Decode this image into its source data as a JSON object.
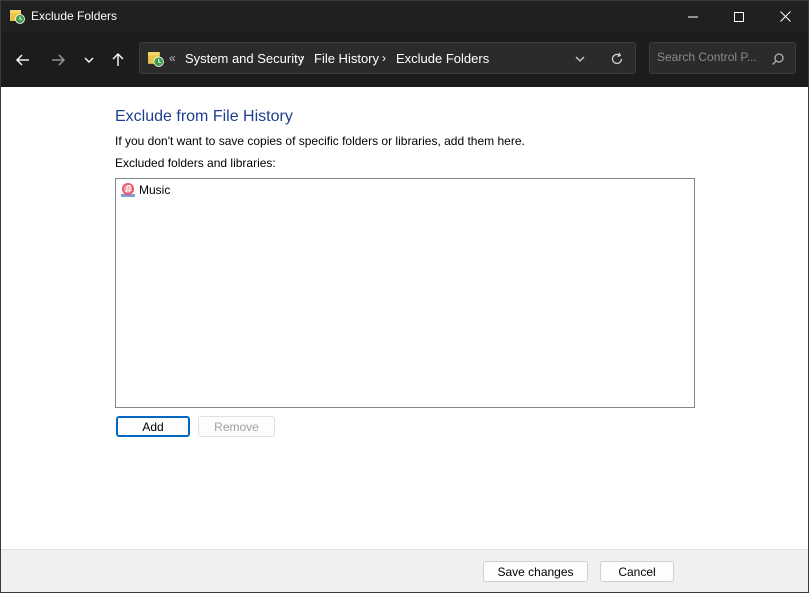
{
  "window": {
    "title": "Exclude Folders"
  },
  "address_bar": {
    "overflow": "«",
    "crumbs": [
      "System and Security",
      "File History",
      "Exclude Folders"
    ],
    "separator": "›"
  },
  "search": {
    "placeholder": "Search Control P...",
    "value": ""
  },
  "content": {
    "heading": "Exclude from File History",
    "description": "If you don't want to save copies of specific folders or libraries, add them here.",
    "list_label": "Excluded folders and libraries:",
    "items": [
      {
        "label": "Music",
        "icon": "music-library-icon"
      }
    ],
    "add_label": "Add",
    "remove_label": "Remove"
  },
  "footer": {
    "save_label": "Save changes",
    "cancel_label": "Cancel"
  },
  "colors": {
    "titlebar": "#202020",
    "navbar": "#1c1c1c",
    "heading": "#1e3f8f",
    "focus_accent": "#0067c0"
  }
}
